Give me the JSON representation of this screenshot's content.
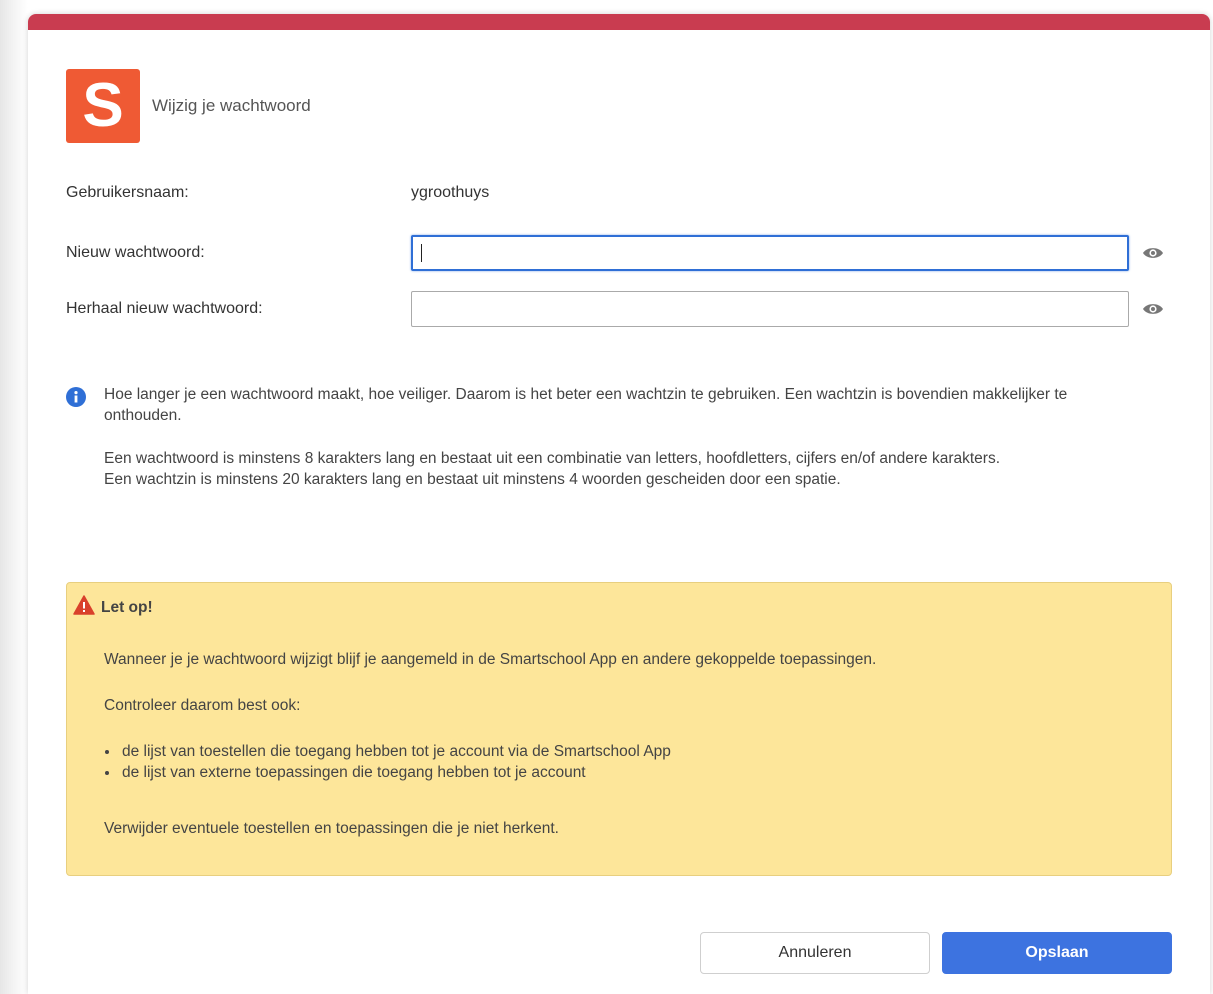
{
  "header": {
    "logo_letter": "S",
    "title": "Wijzig je wachtwoord"
  },
  "form": {
    "username_label": "Gebruikersnaam:",
    "username_value": "ygroothuys",
    "new_password_label": "Nieuw wachtwoord:",
    "new_password_value": "",
    "repeat_password_label": "Herhaal nieuw wachtwoord:",
    "repeat_password_value": ""
  },
  "info": {
    "icon": "info-icon",
    "paragraph1": "Hoe langer je een wachtwoord maakt, hoe veiliger. Daarom is het beter een wachtzin te gebruiken. Een wachtzin is bovendien makkelijker te onthouden.",
    "paragraph2": "Een wachtwoord is minstens 8 karakters lang en bestaat uit een combinatie van letters, hoofdletters, cijfers en/of andere karakters.",
    "paragraph3": "Een wachtzin is minstens 20 karakters lang en bestaat uit minstens 4 woorden gescheiden door een spatie."
  },
  "warning": {
    "icon": "warning-icon",
    "title": "Let op!",
    "text1": "Wanneer je je wachtwoord wijzigt blijf je aangemeld in de Smartschool App en andere gekoppelde toepassingen.",
    "text2": "Controleer daarom best ook:",
    "items": [
      "de lijst van toestellen die toegang hebben tot je account via de Smartschool App",
      "de lijst van externe toepassingen die toegang hebben tot je account"
    ],
    "text3": "Verwijder eventuele toestellen en toepassingen die je niet herkent."
  },
  "buttons": {
    "cancel": "Annuleren",
    "save": "Opslaan"
  },
  "colors": {
    "top_bar": "#c93c50",
    "logo": "#ef5a34",
    "primary": "#3d73e0",
    "focus": "#2f6fd6",
    "warning_bg": "#fde69a",
    "warning_icon": "#d9412b",
    "info_icon": "#2f6fd6"
  }
}
